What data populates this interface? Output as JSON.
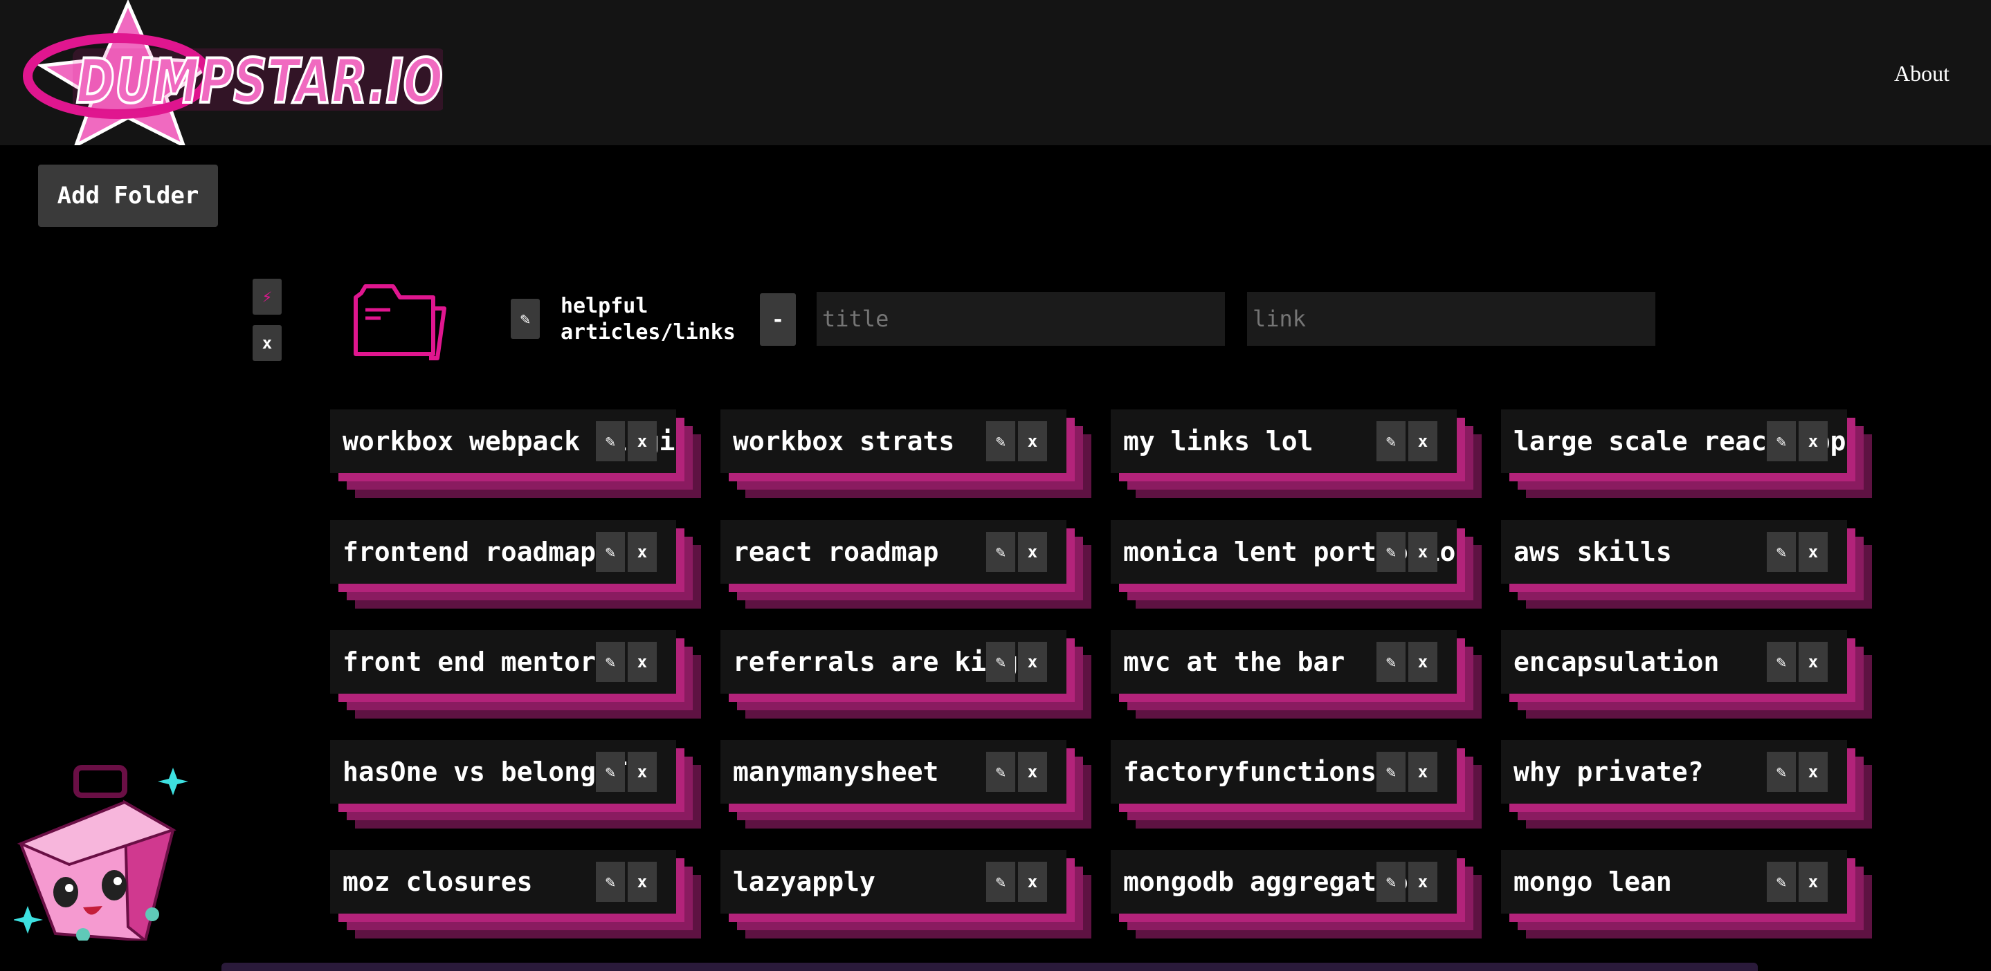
{
  "app": {
    "logo_text": "DUMPSTAR.IO"
  },
  "nav": {
    "about_label": "About"
  },
  "toolbar": {
    "add_folder_label": "Add Folder"
  },
  "folder": {
    "lightning_icon": "⚡",
    "remove_label": "x",
    "edit_icon": "✎",
    "name": "helpful\narticles/links",
    "collapse_label": "-",
    "title_placeholder": "title",
    "link_placeholder": "link"
  },
  "card_buttons": {
    "edit_icon": "✎",
    "delete_label": "x"
  },
  "links": [
    [
      "workbox webpack plugin",
      "workbox strats",
      "my links lol",
      "large scale react app"
    ],
    [
      "frontend roadmap",
      "react roadmap",
      "monica lent portfolio",
      "aws skills"
    ],
    [
      "front end mentor",
      "referrals are king",
      "mvc at the bar",
      "encapsulation"
    ],
    [
      "hasOne vs belongsTo",
      "manymanysheet",
      "factoryfunctions",
      "why private?"
    ],
    [
      "moz closures",
      "lazyapply",
      "mongodb aggregation",
      "mongo lean"
    ]
  ],
  "colors": {
    "accent": "#e0168f",
    "shadow1": "#b3237a",
    "shadow2": "#8a1b60",
    "shadow3": "#5e1242",
    "card_bg": "#141414",
    "topbar_bg": "#141414"
  }
}
